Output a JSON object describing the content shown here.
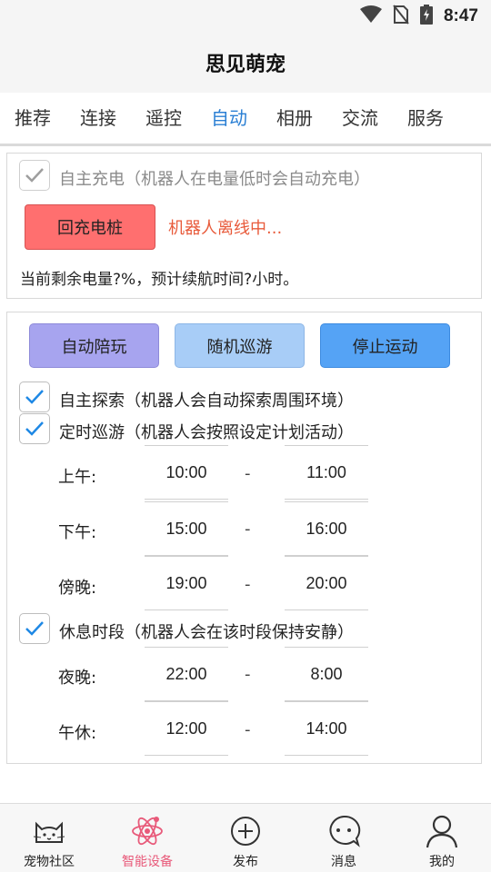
{
  "status": {
    "time": "8:47"
  },
  "app": {
    "title": "思见萌宠"
  },
  "tabs": [
    {
      "label": "推荐"
    },
    {
      "label": "连接"
    },
    {
      "label": "遥控"
    },
    {
      "label": "自动"
    },
    {
      "label": "相册"
    },
    {
      "label": "交流"
    },
    {
      "label": "服务"
    }
  ],
  "active_tab": "自动",
  "charge": {
    "auto_charge_label": "自主充电（机器人在电量低时会自动充电）",
    "auto_charge_checked": true,
    "dock_button": "回充电桩",
    "offline_status": "机器人离线中...",
    "battery_text": "当前剩余电量?%，预计续航时间?小时。"
  },
  "actions": {
    "play": "自动陪玩",
    "roam": "随机巡游",
    "stop": "停止运动"
  },
  "explore": {
    "label": "自主探索（机器人会自动探索周围环境）",
    "checked": true
  },
  "patrol": {
    "label": "定时巡游（机器人会按照设定计划活动）",
    "checked": true,
    "slots": [
      {
        "name": "上午:",
        "start": "10:00",
        "end": "11:00"
      },
      {
        "name": "下午:",
        "start": "15:00",
        "end": "16:00"
      },
      {
        "name": "傍晚:",
        "start": "19:00",
        "end": "20:00"
      }
    ]
  },
  "rest": {
    "label": "休息时段（机器人会在该时段保持安静）",
    "checked": true,
    "slots": [
      {
        "name": "夜晚:",
        "start": "22:00",
        "end": "8:00"
      },
      {
        "name": "午休:",
        "start": "12:00",
        "end": "14:00"
      }
    ]
  },
  "separator": "-",
  "bottom_nav": [
    {
      "label": "宠物社区",
      "icon": "cat-icon"
    },
    {
      "label": "智能设备",
      "icon": "atom-icon"
    },
    {
      "label": "发布",
      "icon": "plus-circle-icon"
    },
    {
      "label": "消息",
      "icon": "chat-bubble-icon"
    },
    {
      "label": "我的",
      "icon": "user-icon"
    }
  ],
  "colors": {
    "accent_blue": "#2a7fd4",
    "check_blue": "#1e88e5",
    "dock_red": "#ff6f6f",
    "offline_red": "#e85a3a",
    "play_purple": "#a7a4ef",
    "roam_blue": "#a8cdf7",
    "stop_blue": "#55a3f5",
    "nav_active_pink": "#e85a7a"
  }
}
